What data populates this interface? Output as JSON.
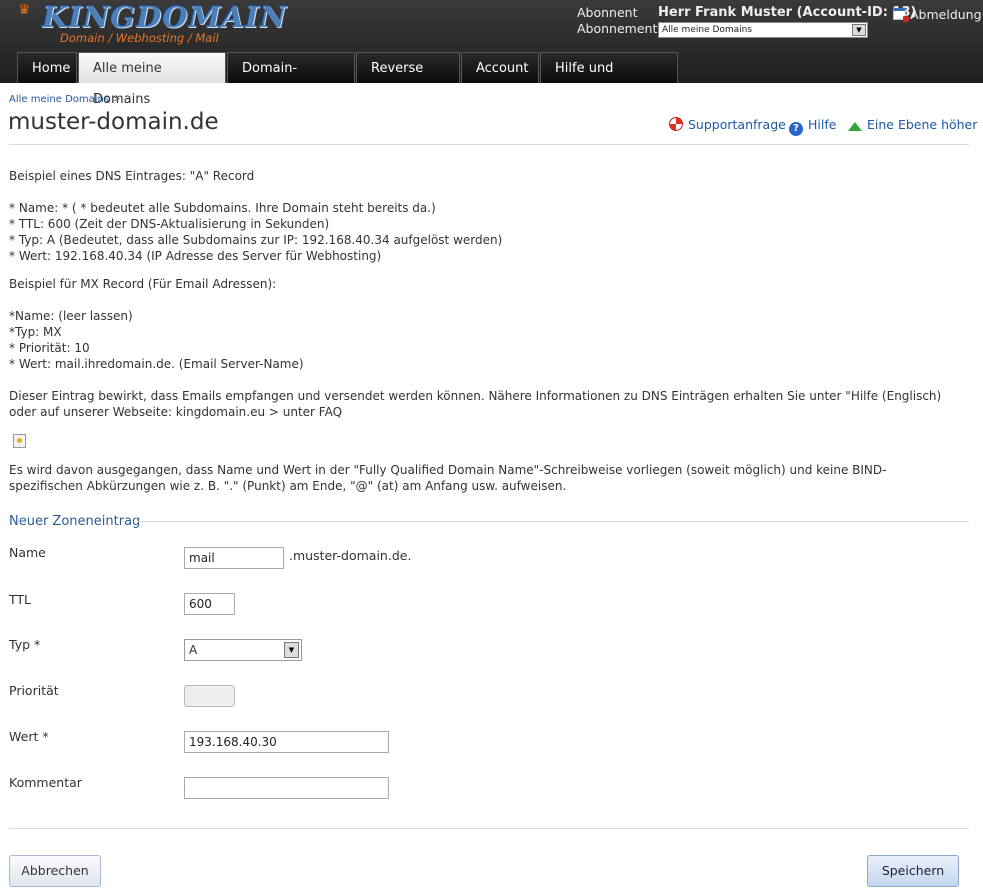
{
  "brand": {
    "name": "KINGDOMAIN",
    "tagline": "Domain / Webhosting / Mail"
  },
  "account": {
    "label_subscriber": "Abonnent",
    "label_subscription": "Abonnement",
    "user": "Herr Frank Muster (Account-ID: 13)",
    "subscription_value": "Alle meine Domains",
    "logout": "Abmeldung"
  },
  "nav": {
    "tabs": [
      {
        "label": "Home"
      },
      {
        "label": "Alle meine Domains"
      },
      {
        "label": "Domain-Kontakte"
      },
      {
        "label": "Reverse DNS"
      },
      {
        "label": "Account"
      },
      {
        "label": "Hilfe und Support"
      }
    ],
    "active": "Alle meine Domains"
  },
  "breadcrumb": {
    "item": "Alle meine Domains",
    "sep": ">"
  },
  "page": {
    "title": "muster-domain.de",
    "links": {
      "support": "Supportanfrage",
      "help": "Hilfe",
      "up": "Eine Ebene höher"
    }
  },
  "info": {
    "a_intro": "Beispiel eines DNS Eintrages: \"A\" Record",
    "a_lines": [
      "* Name: * ( * bedeutet alle Subdomains. Ihre Domain steht bereits da.)",
      "* TTL: 600 (Zeit der DNS-Aktualisierung in Sekunden)",
      "* Typ: A (Bedeutet, dass alle Subdomains zur IP: 192.168.40.34 aufgelöst werden)",
      "* Wert: 192.168.40.34 (IP Adresse des Server für Webhosting)"
    ],
    "mx_intro": "Beispiel für MX Record (Für Email Adressen):",
    "mx_lines": [
      "*Name: (leer lassen)",
      "*Typ: MX",
      "* Priorität: 10",
      "* Wert: mail.ihredomain.de. (Email Server-Name)"
    ],
    "note": "Dieser Eintrag bewirkt, dass Emails empfangen und versendet werden können. Nähere Informationen zu DNS Einträgen erhalten Sie unter \"Hilfe (Englisch) oder auf unserer Webseite: kingdomain.eu > unter FAQ",
    "fqdn_note": "Es wird davon ausgegangen, dass Name und Wert in der \"Fully Qualified Domain Name\"-Schreibweise vorliegen (soweit möglich) und keine BIND-spezifischen Abkürzungen wie z. B. \".\" (Punkt) am Ende, \"@\" (at) am Anfang usw. aufweisen."
  },
  "form": {
    "section_title": "Neuer Zoneneintrag",
    "name": {
      "label": "Name",
      "value": "mail",
      "suffix": ".muster-domain.de."
    },
    "ttl": {
      "label": "TTL",
      "value": "600"
    },
    "type": {
      "label": "Typ *",
      "value": "A"
    },
    "priority": {
      "label": "Priorität",
      "value": ""
    },
    "value": {
      "label": "Wert *",
      "value": "193.168.40.30"
    },
    "comment": {
      "label": "Kommentar",
      "value": ""
    }
  },
  "buttons": {
    "cancel": "Abbrechen",
    "save": "Speichern"
  }
}
